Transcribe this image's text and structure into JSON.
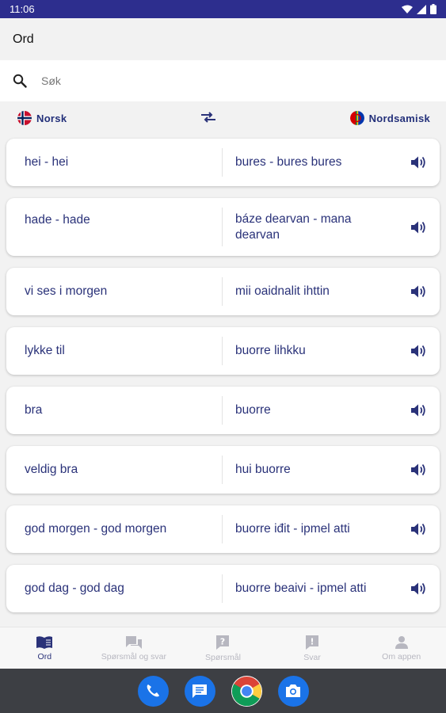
{
  "status_bar": {
    "time": "11:06"
  },
  "app_bar": {
    "title": "Ord"
  },
  "search": {
    "placeholder": "Søk"
  },
  "languages": {
    "source": "Norsk",
    "target": "Nordsamisk"
  },
  "entries": [
    {
      "norwegian": "hei - hei",
      "sami": "bures - bures bures"
    },
    {
      "norwegian": "hade - hade",
      "sami": "báze dearvan - mana dearvan"
    },
    {
      "norwegian": "vi ses i morgen",
      "sami": "mii oaidnalit ihttin"
    },
    {
      "norwegian": "lykke til",
      "sami": "buorre lihkku"
    },
    {
      "norwegian": "bra",
      "sami": "buorre"
    },
    {
      "norwegian": "veldig bra",
      "sami": "hui buorre"
    },
    {
      "norwegian": "god morgen - god morgen",
      "sami": "buorre iđit - ipmel atti"
    },
    {
      "norwegian": "god dag - god dag",
      "sami": "buorre beaivi - ipmel atti"
    }
  ],
  "bottom_nav": [
    {
      "label": "Ord",
      "icon": "book-icon",
      "active": true
    },
    {
      "label": "Spørsmål og svar",
      "icon": "forum-icon",
      "active": false
    },
    {
      "label": "Spørsmål",
      "icon": "question-icon",
      "active": false
    },
    {
      "label": "Svar",
      "icon": "answer-icon",
      "active": false
    },
    {
      "label": "Om appen",
      "icon": "person-icon",
      "active": false
    }
  ],
  "dock": [
    {
      "name": "phone-app",
      "icon": "phone-icon",
      "color": "#1a73e8"
    },
    {
      "name": "messages-app",
      "icon": "message-icon",
      "color": "#1a73e8"
    },
    {
      "name": "chrome-app",
      "icon": "chrome-icon",
      "color": "#ffffff"
    },
    {
      "name": "camera-app",
      "icon": "camera-icon",
      "color": "#1a73e8"
    }
  ],
  "colors": {
    "status_bar": "#2d2e8e",
    "accent": "#2a3279",
    "dock": "#3d3f44"
  }
}
